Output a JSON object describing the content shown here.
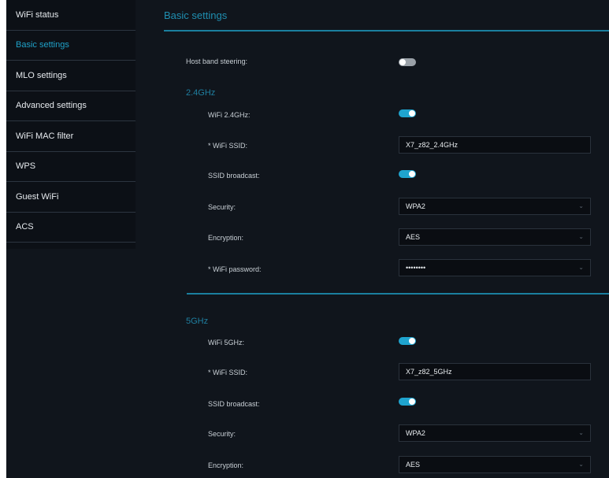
{
  "sidebar": {
    "items": [
      {
        "label": "WiFi status"
      },
      {
        "label": "Basic settings"
      },
      {
        "label": "MLO settings"
      },
      {
        "label": "Advanced settings"
      },
      {
        "label": "WiFi MAC filter"
      },
      {
        "label": "WPS"
      },
      {
        "label": "Guest WiFi"
      },
      {
        "label": "ACS"
      }
    ]
  },
  "page": {
    "title": "Basic settings",
    "host_band_steering_label": "Host band steering:"
  },
  "band_24": {
    "heading": "2.4GHz",
    "wifi_label": "WiFi 2.4GHz:",
    "ssid_label": "* WiFi SSID:",
    "ssid_value": "X7_z82_2.4GHz",
    "broadcast_label": "SSID broadcast:",
    "security_label": "Security:",
    "security_value": "WPA2",
    "encryption_label": "Encryption:",
    "encryption_value": "AES",
    "password_label": "* WiFi password:",
    "password_value": "••••••••"
  },
  "band_5": {
    "heading": "5GHz",
    "wifi_label": "WiFi 5GHz:",
    "ssid_label": "* WiFi SSID:",
    "ssid_value": "X7_z82_5GHz",
    "broadcast_label": "SSID broadcast:",
    "security_label": "Security:",
    "security_value": "WPA2",
    "encryption_label": "Encryption:",
    "encryption_value": "AES"
  },
  "colors": {
    "accent": "#1fa1c8",
    "background": "#10151c",
    "toggle_on": "#1fa4cf",
    "toggle_off": "#9aa1a8"
  }
}
